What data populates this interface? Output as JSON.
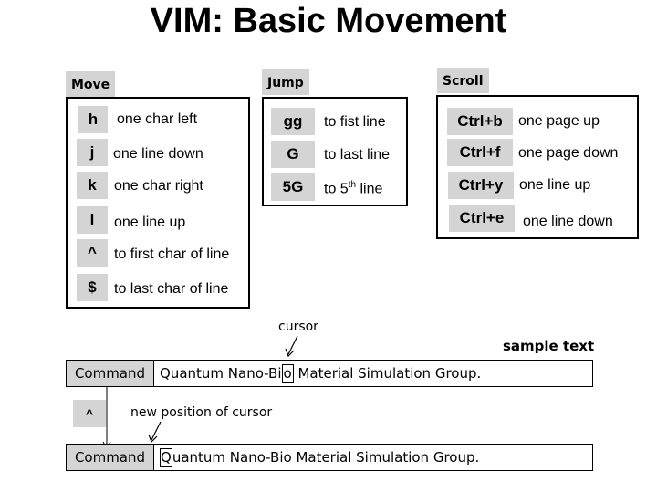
{
  "title": "VIM: Basic Movement",
  "move": {
    "label": "Move",
    "items": [
      {
        "key": "h",
        "desc": "one char left"
      },
      {
        "key": "j",
        "desc": "one line down"
      },
      {
        "key": "k",
        "desc": "one char right"
      },
      {
        "key": "l",
        "desc": "one line up"
      },
      {
        "key": "^",
        "desc": "to first char of line"
      },
      {
        "key": "$",
        "desc": "to last char of line"
      }
    ]
  },
  "jump": {
    "label": "Jump",
    "items": [
      {
        "key": "gg",
        "desc": "to fist line"
      },
      {
        "key": "G",
        "desc": "to last line"
      },
      {
        "key": "5G",
        "desc_pre": "to 5",
        "desc_sup": "th",
        "desc_post": " line"
      }
    ]
  },
  "scroll": {
    "label": "Scroll",
    "items": [
      {
        "key": "Ctrl+b",
        "desc": "one page up"
      },
      {
        "key": "Ctrl+f",
        "desc": "one page down"
      },
      {
        "key": "Ctrl+y",
        "desc": "one line up"
      },
      {
        "key": "Ctrl+e",
        "desc": "one line down"
      }
    ]
  },
  "example": {
    "cursor_label": "cursor",
    "sample_label": "sample text",
    "mode_label": "Command",
    "text_before": "Quantum Nano-Bi",
    "cursor_char": "o",
    "text_after": " Material Simulation Group.",
    "key_pressed": "^",
    "new_cursor_label": "new position of cursor",
    "new_cursor_char": "Q",
    "new_text_after": "uantum Nano-Bio Material Simulation Group."
  }
}
